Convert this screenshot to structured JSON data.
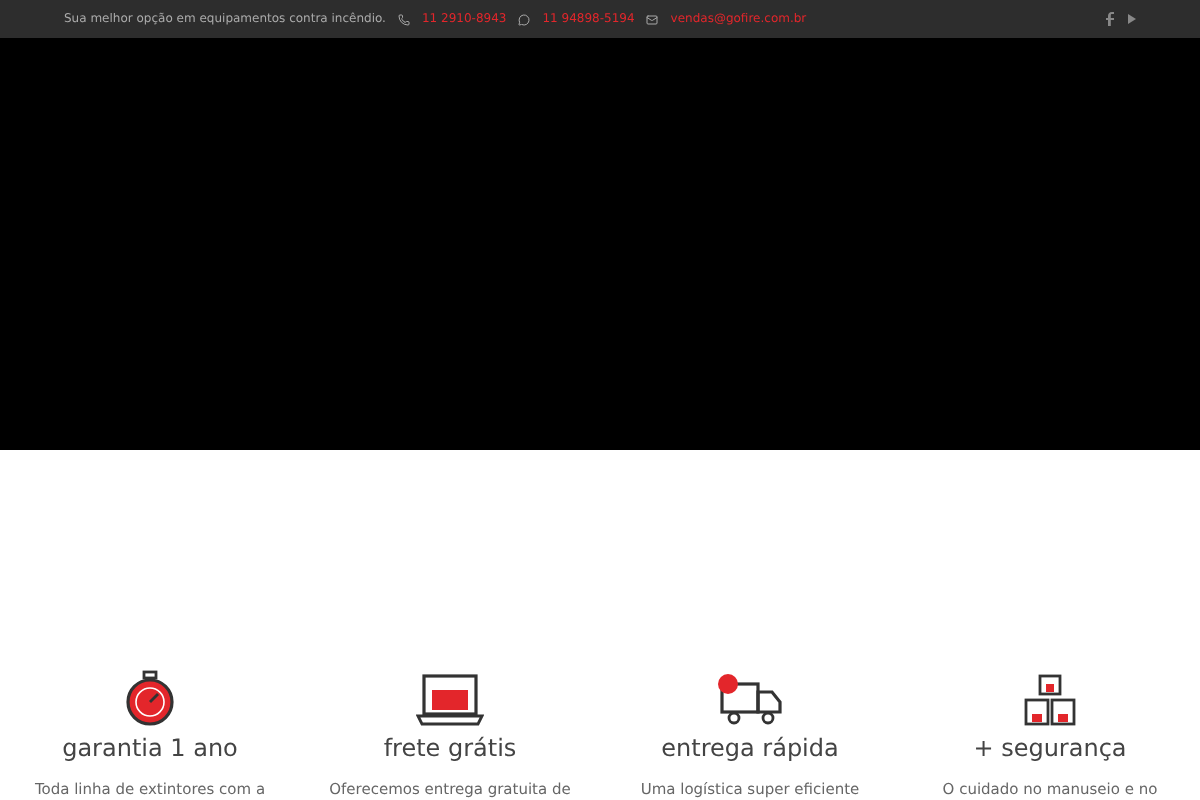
{
  "top_bar": {
    "tagline": "Sua melhor opção em equipamentos contra incêndio.",
    "phone": "11 2910-8943",
    "whatsapp": "11 94898-5194",
    "email": "vendas@gofire.com.br"
  },
  "hero": {
    "kind": "video"
  },
  "features": [
    {
      "kind": "stopwatch",
      "title": "garantia 1 ano",
      "text": "Toda linha de extintores com a"
    },
    {
      "kind": "laptop",
      "title": "frete grátis",
      "text": "Oferecemos entrega gratuita de"
    },
    {
      "kind": "truck",
      "title": "entrega rápida",
      "text": "Uma logística super eficiente"
    },
    {
      "kind": "boxes",
      "title": "+ segurança",
      "text": "O cuidado no manuseio e no"
    }
  ]
}
